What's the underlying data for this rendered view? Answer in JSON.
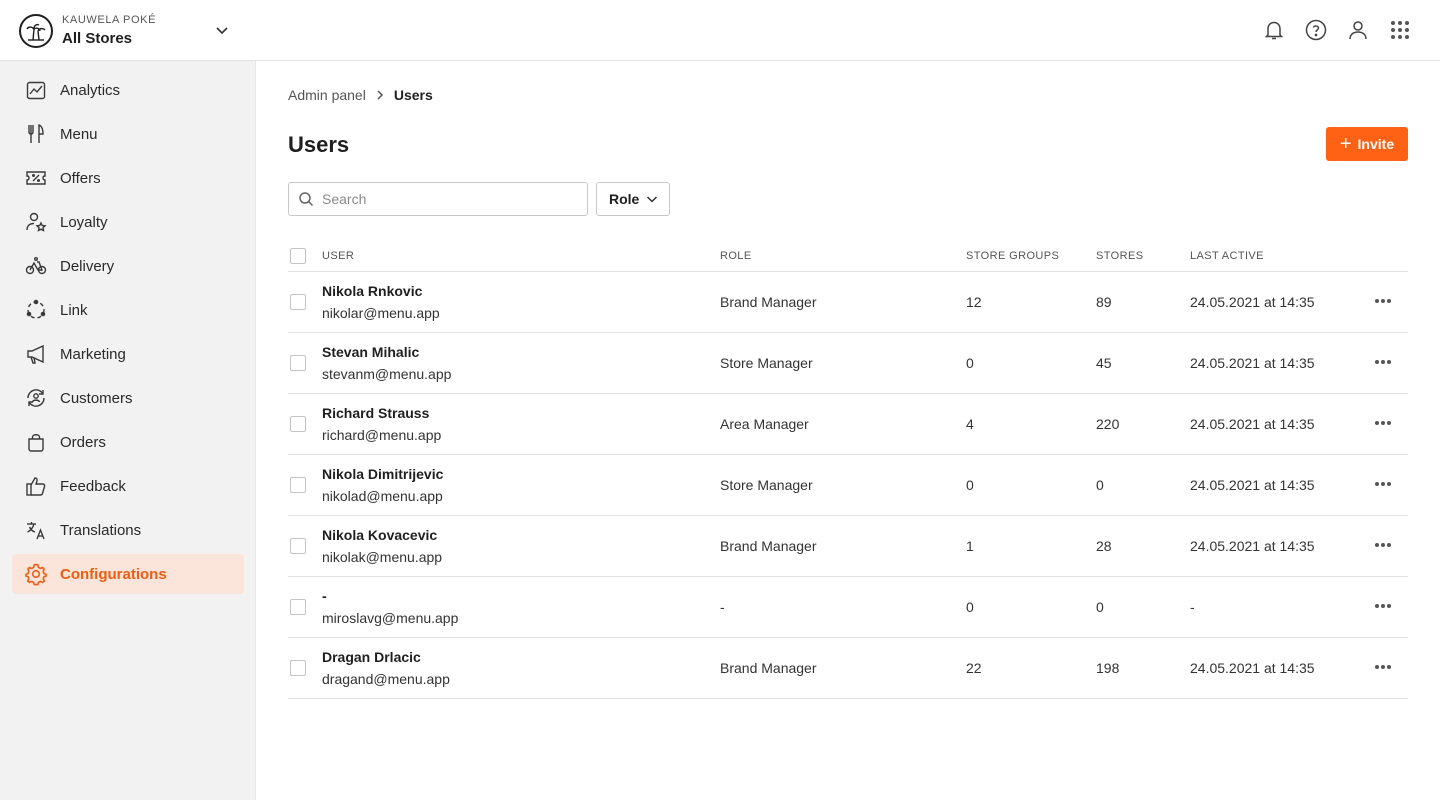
{
  "header": {
    "brand_name": "KAUWELA POKÉ",
    "store_selector": "All Stores",
    "icons": [
      "bell-icon",
      "help-icon",
      "user-icon",
      "apps-grid-icon"
    ]
  },
  "sidebar": {
    "items": [
      {
        "label": "Analytics",
        "icon": "analytics-icon"
      },
      {
        "label": "Menu",
        "icon": "utensils-icon"
      },
      {
        "label": "Offers",
        "icon": "ticket-icon"
      },
      {
        "label": "Loyalty",
        "icon": "loyalty-user-icon"
      },
      {
        "label": "Delivery",
        "icon": "bike-icon"
      },
      {
        "label": "Link",
        "icon": "link-circle-icon"
      },
      {
        "label": "Marketing",
        "icon": "megaphone-icon"
      },
      {
        "label": "Customers",
        "icon": "customers-icon"
      },
      {
        "label": "Orders",
        "icon": "bag-icon"
      },
      {
        "label": "Feedback",
        "icon": "thumbs-up-icon"
      },
      {
        "label": "Translations",
        "icon": "translate-icon"
      },
      {
        "label": "Configurations",
        "icon": "gear-icon",
        "active": true
      }
    ],
    "accent_color": "#f05d12",
    "active_bg": "#fbe4da"
  },
  "breadcrumb": {
    "parent": "Admin panel",
    "current": "Users"
  },
  "page": {
    "title": "Users",
    "invite_label": "Invite",
    "invite_color": "#ff6214",
    "search_placeholder": "Search",
    "role_filter_label": "Role"
  },
  "table": {
    "headers": {
      "user": "USER",
      "role": "ROLE",
      "store_groups": "STORE GROUPS",
      "stores": "STORES",
      "last_active": "LAST ACTIVE"
    },
    "rows": [
      {
        "name": "Nikola Rnkovic",
        "email": "nikolar@menu.app",
        "role": "Brand Manager",
        "store_groups": "12",
        "stores": "89",
        "last_active": "24.05.2021 at 14:35"
      },
      {
        "name": "Stevan Mihalic",
        "email": "stevanm@menu.app",
        "role": "Store Manager",
        "store_groups": "0",
        "stores": "45",
        "last_active": "24.05.2021 at 14:35"
      },
      {
        "name": "Richard Strauss",
        "email": "richard@menu.app",
        "role": "Area Manager",
        "store_groups": "4",
        "stores": "220",
        "last_active": "24.05.2021 at 14:35"
      },
      {
        "name": "Nikola Dimitrijevic",
        "email": "nikolad@menu.app",
        "role": "Store Manager",
        "store_groups": "0",
        "stores": "0",
        "last_active": "24.05.2021 at 14:35"
      },
      {
        "name": "Nikola Kovacevic",
        "email": "nikolak@menu.app",
        "role": "Brand Manager",
        "store_groups": "1",
        "stores": "28",
        "last_active": "24.05.2021 at 14:35"
      },
      {
        "name": "-",
        "email": "miroslavg@menu.app",
        "role": "-",
        "store_groups": "0",
        "stores": "0",
        "last_active": "-"
      },
      {
        "name": "Dragan Drlacic",
        "email": "dragand@menu.app",
        "role": "Brand Manager",
        "store_groups": "22",
        "stores": "198",
        "last_active": "24.05.2021 at 14:35"
      }
    ]
  }
}
